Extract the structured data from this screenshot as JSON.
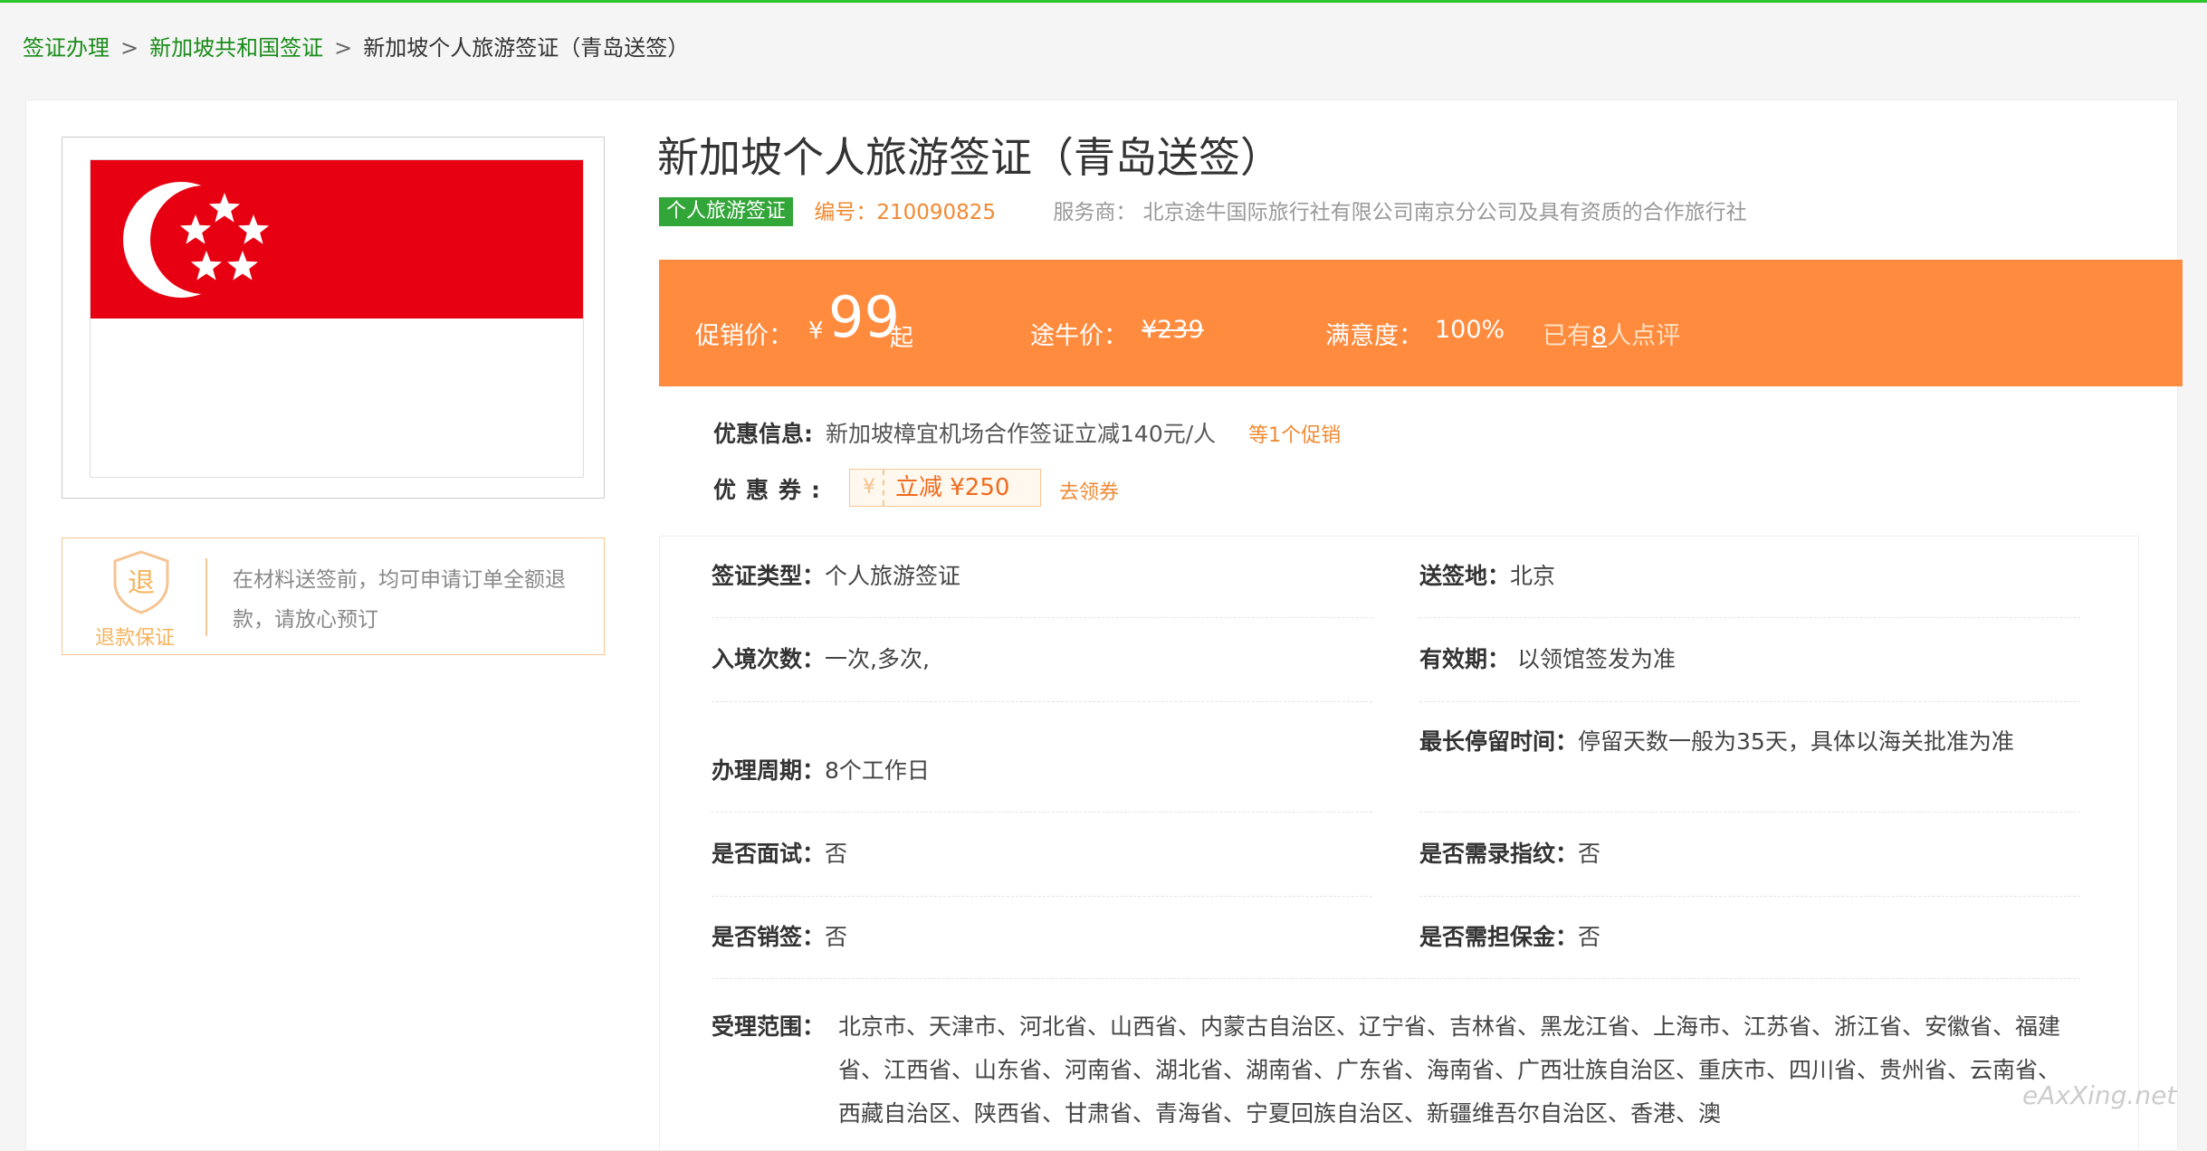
{
  "breadcrumb": {
    "items": [
      "签证办理",
      "新加坡共和国签证",
      "新加坡个人旅游签证（青岛送签）"
    ],
    "separator": ">"
  },
  "guarantee": {
    "icon_char": "退",
    "label": "退款保证",
    "text": "在材料送签前，均可申请订单全额退款，请放心预订"
  },
  "product": {
    "title": "新加坡个人旅游签证（青岛送签）",
    "tag": "个人旅游签证",
    "code": "编号：210090825",
    "supplier": "服务商： 北京途牛国际旅行社有限公司南京分公司及具有资质的合作旅行社"
  },
  "price": {
    "promo_label": "促销价：",
    "currency": "¥",
    "promo_price": "99",
    "qi": "起",
    "tuniu_label": "途牛价：",
    "tuniu_price": "¥239",
    "satisfaction_label": "满意度：",
    "satisfaction_value": "100%",
    "reviews_prefix": "已有",
    "reviews_count": "8",
    "reviews_suffix": "人点评"
  },
  "promo": {
    "label": "优惠信息:",
    "text": "新加坡樟宜机场合作签证立减140元/人",
    "more": "等1个促销"
  },
  "coupon": {
    "label": "优惠券:",
    "yen": "¥",
    "value": "立减 ¥250",
    "get": "去领券"
  },
  "info": {
    "visa_type": {
      "k": "签证类型：",
      "v": "个人旅游签证"
    },
    "send_place": {
      "k": "送签地：",
      "v": "北京"
    },
    "entries": {
      "k": "入境次数：",
      "v": "一次,多次,"
    },
    "validity": {
      "k": "有效期：",
      "v": " 以领馆签发为准"
    },
    "period": {
      "k": "办理周期：",
      "v": "8个工作日"
    },
    "max_stay": {
      "k": "最长停留时间：",
      "v": "停留天数一般为35天，具体以海关批准为准"
    },
    "interview": {
      "k": "是否面试：",
      "v": "否"
    },
    "fingerprint": {
      "k": "是否需录指纹：",
      "v": "否"
    },
    "cancel": {
      "k": "是否销签：",
      "v": "否"
    },
    "deposit": {
      "k": "是否需担保金：",
      "v": "否"
    },
    "scope": {
      "k": "受理范围：",
      "v": "北京市、天津市、河北省、山西省、内蒙古自治区、辽宁省、吉林省、黑龙江省、上海市、江苏省、浙江省、安徽省、福建省、江西省、山东省、河南省、湖北省、湖南省、广东省、海南省、广西壮族自治区、重庆市、四川省、贵州省、云南省、西藏自治区、陕西省、甘肃省、青海省、宁夏回族自治区、新疆维吾尔自治区、香港、澳"
    }
  },
  "watermark": "eAxXing.net",
  "colors": {
    "accent_green": "#33a63a",
    "link_green": "#1a8c1a",
    "price_bar": "#ff8b3e",
    "flag_red": "#e60012",
    "orange_text": "#f08a33"
  }
}
